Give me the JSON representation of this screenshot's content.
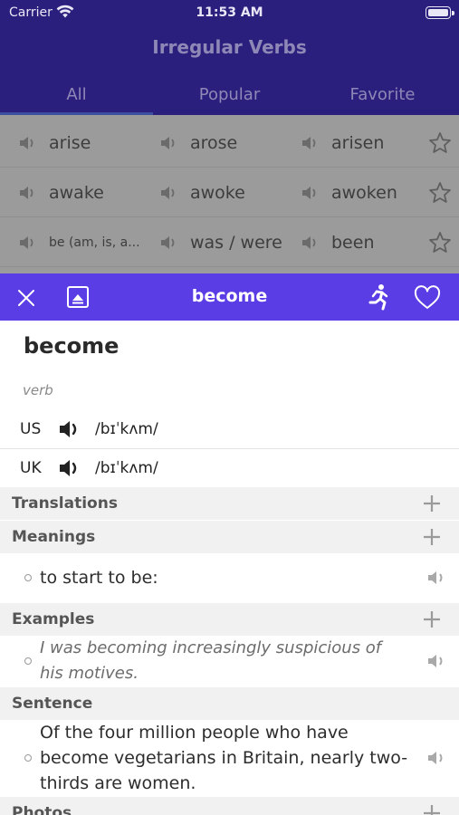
{
  "status": {
    "carrier": "Carrier",
    "time": "11:53 AM"
  },
  "app": {
    "title": "Irregular Verbs"
  },
  "tabs": [
    "All",
    "Popular",
    "Favorite"
  ],
  "verbs": [
    {
      "base": "arise",
      "past": "arose",
      "participle": "arisen"
    },
    {
      "base": "awake",
      "past": "awoke",
      "participle": "awoken"
    },
    {
      "base": "be (am, is, a...",
      "past": "was / were",
      "participle": "been"
    }
  ],
  "sheet": {
    "title": "become",
    "word": "become",
    "part_of_speech": "verb",
    "pronunciations": [
      {
        "region": "US",
        "ipa": "/bɪˈkʌm/"
      },
      {
        "region": "UK",
        "ipa": "/bɪˈkʌm/"
      }
    ],
    "sections": {
      "translations": "Translations",
      "meanings": "Meanings",
      "examples": "Examples",
      "sentence": "Sentence",
      "photos": "Photos"
    },
    "meaning": "to start to be:",
    "example_line1": "I was becoming increasingly suspicious of",
    "example_line2": "his motives.",
    "sentence_line1": "Of the four million people who have",
    "sentence_line2": "become vegetarians in Britain, nearly two-",
    "sentence_line3": "thirds are women."
  },
  "colors": {
    "header_bg": "#2b1f7e",
    "sheet_header_bg": "#5b3de6",
    "section_bg": "#f1f1f1"
  },
  "icons": [
    "wifi-icon",
    "battery-icon",
    "speaker-icon",
    "star-icon",
    "close-icon",
    "photo-icon",
    "runner-icon",
    "heart-icon",
    "plus-icon"
  ]
}
